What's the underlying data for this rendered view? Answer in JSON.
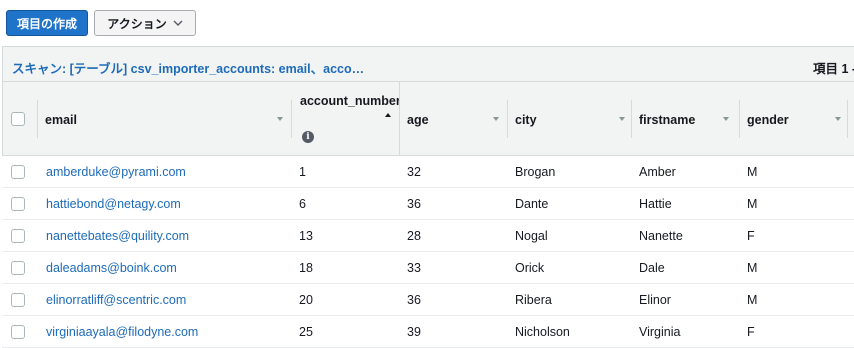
{
  "toolbar": {
    "create_item_label": "項目の作成",
    "actions_label": "アクション"
  },
  "panel": {
    "title": "スキャン: [テーブル] csv_importer_accounts: email、acco…",
    "pager": "項目 1 -"
  },
  "columns": [
    {
      "key": "email",
      "label": "email"
    },
    {
      "key": "account_number",
      "label": "account_number"
    },
    {
      "key": "age",
      "label": "age"
    },
    {
      "key": "city",
      "label": "city"
    },
    {
      "key": "firstname",
      "label": "firstname"
    },
    {
      "key": "gender",
      "label": "gender"
    }
  ],
  "rows": [
    {
      "email": "amberduke@pyrami.com",
      "account_number": "1",
      "age": "32",
      "city": "Brogan",
      "firstname": "Amber",
      "gender": "M"
    },
    {
      "email": "hattiebond@netagy.com",
      "account_number": "6",
      "age": "36",
      "city": "Dante",
      "firstname": "Hattie",
      "gender": "M"
    },
    {
      "email": "nanettebates@quility.com",
      "account_number": "13",
      "age": "28",
      "city": "Nogal",
      "firstname": "Nanette",
      "gender": "F"
    },
    {
      "email": "daleadams@boink.com",
      "account_number": "18",
      "age": "33",
      "city": "Orick",
      "firstname": "Dale",
      "gender": "M"
    },
    {
      "email": "elinorratliff@scentric.com",
      "account_number": "20",
      "age": "36",
      "city": "Ribera",
      "firstname": "Elinor",
      "gender": "M"
    },
    {
      "email": "virginiaayala@filodyne.com",
      "account_number": "25",
      "age": "39",
      "city": "Nicholson",
      "firstname": "Virginia",
      "gender": "F"
    }
  ]
}
